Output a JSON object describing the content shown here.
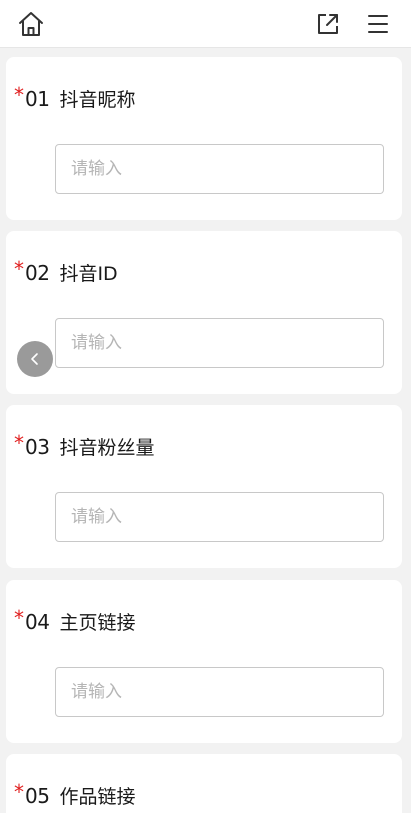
{
  "topbar": {
    "home_icon": "home-icon",
    "share_icon": "external-link-icon",
    "menu_icon": "hamburger-menu-icon"
  },
  "questions": [
    {
      "required_mark": "*",
      "number": "01",
      "title": "抖音昵称",
      "placeholder": "请输入",
      "value": ""
    },
    {
      "required_mark": "*",
      "number": "02",
      "title": "抖音ID",
      "placeholder": "请输入",
      "value": ""
    },
    {
      "required_mark": "*",
      "number": "03",
      "title": "抖音粉丝量",
      "placeholder": "请输入",
      "value": ""
    },
    {
      "required_mark": "*",
      "number": "04",
      "title": "主页链接",
      "placeholder": "请输入",
      "value": ""
    },
    {
      "required_mark": "*",
      "number": "05",
      "title": "作品链接"
    }
  ],
  "back_button_icon": "chevron-left-icon",
  "colors": {
    "required": "#e02020",
    "page_background": "#f2f2f2",
    "card_background": "#ffffff",
    "placeholder": "#b5b5b5",
    "input_border": "#c8c8c8"
  }
}
